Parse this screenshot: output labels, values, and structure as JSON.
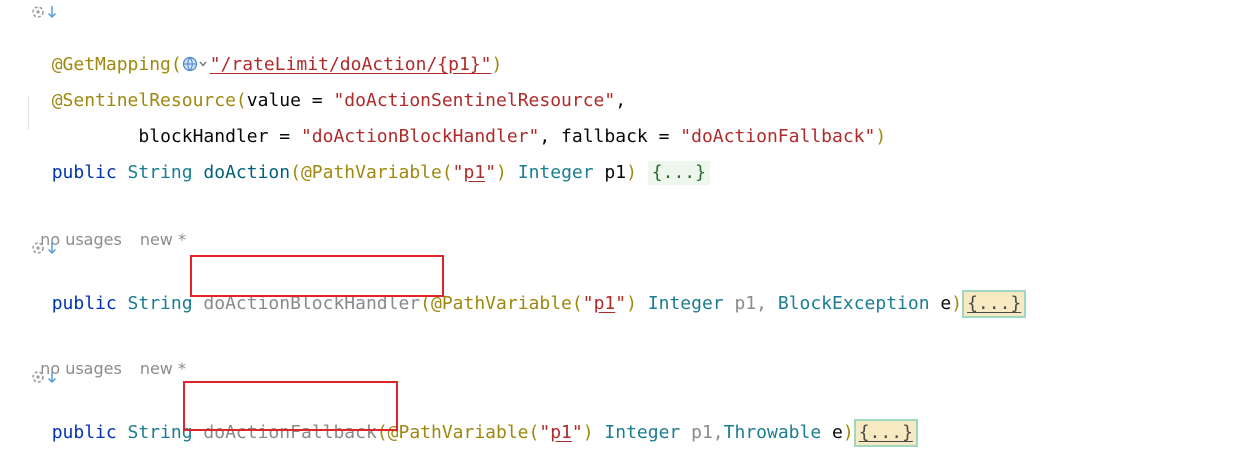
{
  "editor": {
    "block1": {
      "getmapping_ann": "@GetMapping(",
      "getmapping_path": "\"/rateLimit/doAction/{p1}\"",
      "getmapping_close": ")",
      "sentinel_ann": "@SentinelResource(",
      "value_kw": "value = ",
      "value_str": "\"doActionSentinelResource\"",
      "comma": ",",
      "indent": "        ",
      "blockhandler_kw": "blockHandler = ",
      "blockhandler_str": "\"doActionBlockHandler\"",
      "fallback_kw": ", fallback = ",
      "fallback_str": "\"doActionFallback\"",
      "close": ")",
      "sig_public": "public ",
      "sig_type": "String ",
      "sig_name": "doAction",
      "sig_open": "(",
      "sig_pathvar": "@PathVariable(",
      "sig_q1": "\"",
      "sig_p1str": "p1",
      "sig_q2": "\"",
      "sig_pathvar_close": ")",
      "sig_param_type": " Integer",
      "sig_param_name": " p1",
      "sig_close": ") ",
      "sig_fold": "{...}"
    },
    "hint_no_usages": "no usages",
    "hint_new": "new *",
    "block2": {
      "public": "public ",
      "type": "String ",
      "name": "doActionBlockHandler",
      "open": "(",
      "pathvar": "@PathVariable(",
      "q1": "\"",
      "p1str": "p1",
      "q2": "\"",
      "pathvar_close": ")",
      "param1_type": " Integer",
      "param1_name": " p1,",
      "param2_type": " BlockException",
      "param2_name": " e",
      "close": ")",
      "fold": "{...}"
    },
    "block3": {
      "public": "public ",
      "type": "String ",
      "name": "doActionFallback",
      "open": "(",
      "pathvar": "@PathVariable(",
      "q1": "\"",
      "p1str": "p1",
      "q2": "\"",
      "pathvar_close": ")",
      "param1_type": " Integer",
      "param1_name": " p1,",
      "param2_type": "Throwable",
      "param2_name": " e",
      "close": ")",
      "fold": "{...}"
    }
  },
  "icons": {
    "gutter_bean": "spring-bean-icon",
    "gutter_arrow": "navigate-down-arrow-icon",
    "globe": "globe-endpoint-icon"
  },
  "colors": {
    "annotation": "#9e880d",
    "keyword": "#0033b3",
    "type": "#1a7d91",
    "string": "#b02a2a",
    "highlight_box": "#e0242b"
  }
}
